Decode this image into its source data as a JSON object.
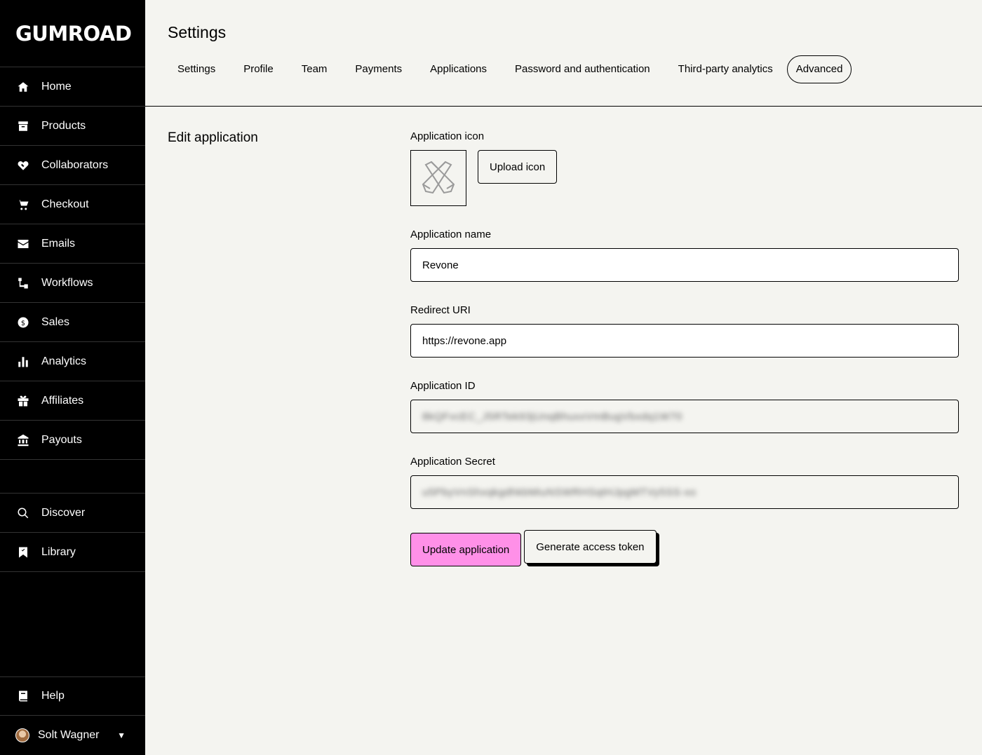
{
  "brand": {
    "logo_text": "GUMROAD"
  },
  "sidebar": {
    "items": [
      {
        "label": "Home",
        "icon": "home-icon"
      },
      {
        "label": "Products",
        "icon": "archive-icon"
      },
      {
        "label": "Collaborators",
        "icon": "handshake-icon"
      },
      {
        "label": "Checkout",
        "icon": "cart-icon"
      },
      {
        "label": "Emails",
        "icon": "envelope-icon"
      },
      {
        "label": "Workflows",
        "icon": "workflow-icon"
      },
      {
        "label": "Sales",
        "icon": "dollar-icon"
      },
      {
        "label": "Analytics",
        "icon": "bar-chart-icon"
      },
      {
        "label": "Affiliates",
        "icon": "gift-icon"
      },
      {
        "label": "Payouts",
        "icon": "bank-icon"
      }
    ],
    "secondary": [
      {
        "label": "Discover",
        "icon": "search-icon"
      },
      {
        "label": "Library",
        "icon": "bookmark-icon"
      }
    ],
    "help_label": "Help",
    "user_name": "Solt Wagner"
  },
  "header": {
    "title": "Settings",
    "tabs": [
      "Settings",
      "Profile",
      "Team",
      "Payments",
      "Applications",
      "Password and authentication",
      "Third-party analytics",
      "Advanced"
    ],
    "active_tab": "Advanced"
  },
  "main": {
    "section_title": "Edit application",
    "icon_label": "Application icon",
    "upload_button": "Upload icon",
    "name_label": "Application name",
    "name_value": "Revone",
    "redirect_label": "Redirect URI",
    "redirect_value": "https://revone.app",
    "app_id_label": "Application ID",
    "app_id_value": "8kQFvcEC_J5RTek93jUnqBhuxxVmBugVbxdq1W70",
    "secret_label": "Application Secret",
    "secret_value": "u5PbyVnShxqkgdhkbMiuNSWRHSqtHJpgMTVy5SS-xo",
    "update_button": "Update application",
    "token_button": "Generate access token"
  }
}
